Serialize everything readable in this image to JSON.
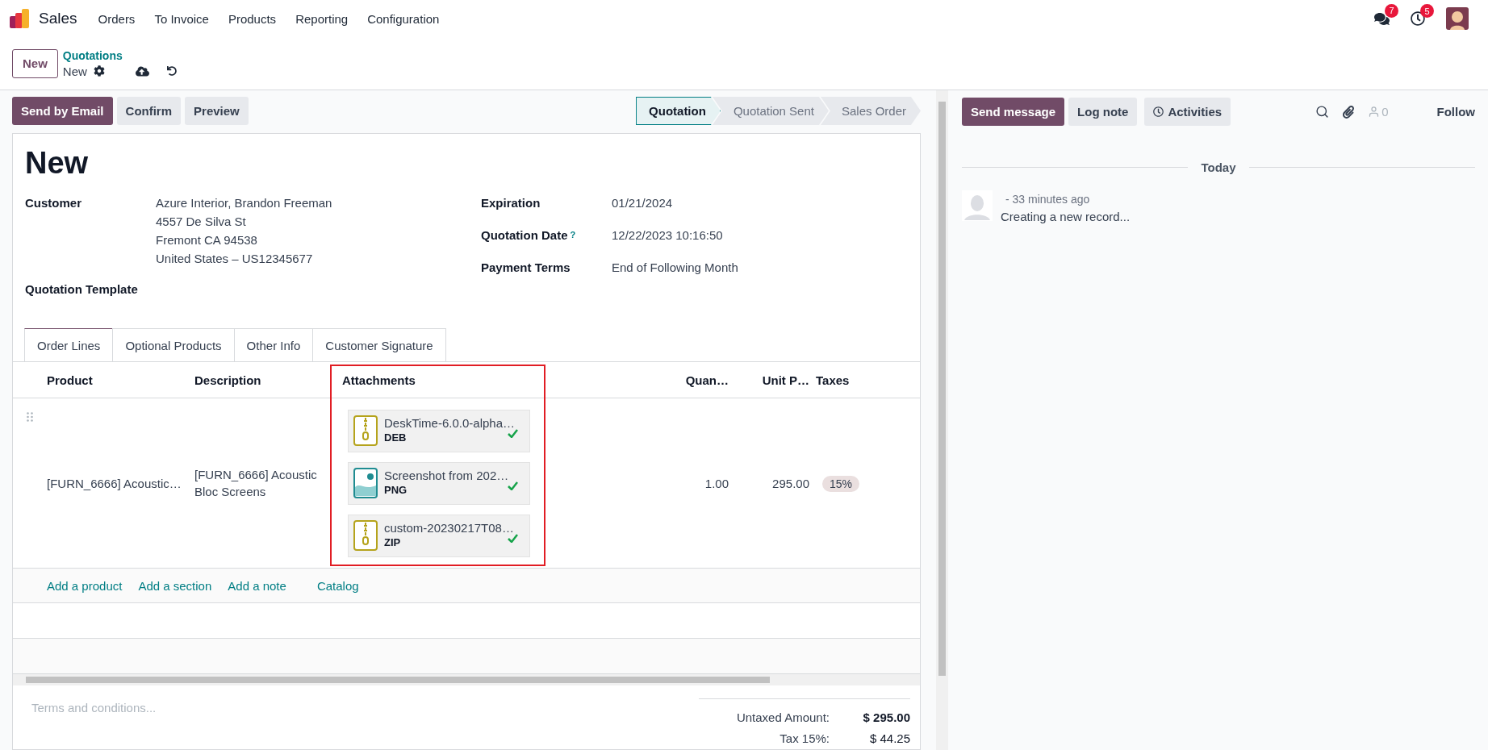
{
  "navbar": {
    "app": "Sales",
    "menu": [
      "Orders",
      "To Invoice",
      "Products",
      "Reporting",
      "Configuration"
    ],
    "messages_badge": "7",
    "activities_badge": "5"
  },
  "control_panel": {
    "new_button": "New",
    "breadcrumb": "Quotations",
    "record": "New"
  },
  "actions": [
    {
      "label": "Send by Email",
      "primary": true
    },
    {
      "label": "Confirm",
      "primary": false
    },
    {
      "label": "Preview",
      "primary": false
    }
  ],
  "statusbar": [
    {
      "label": "Quotation",
      "selected": true
    },
    {
      "label": "Quotation Sent",
      "selected": false
    },
    {
      "label": "Sales Order",
      "selected": false
    }
  ],
  "form": {
    "title": "New",
    "left_fields": [
      {
        "label": "Customer",
        "lines": [
          "Azure Interior, Brandon Freeman",
          "4557 De Silva St",
          "Fremont CA 94538",
          "United States – US12345677"
        ]
      },
      {
        "label": "Quotation Template"
      }
    ],
    "right_fields": [
      {
        "label": "Expiration",
        "value": "01/21/2024"
      },
      {
        "label": "Quotation Date",
        "help": "?",
        "value": "12/22/2023 10:16:50"
      },
      {
        "label": "Payment Terms",
        "value": "End of Following Month"
      }
    ]
  },
  "tabs": [
    {
      "label": "Order Lines",
      "selected": true
    },
    {
      "label": "Optional Products",
      "selected": false
    },
    {
      "label": "Other Info",
      "selected": false
    },
    {
      "label": "Customer Signature",
      "selected": false
    }
  ],
  "table": {
    "columns": [
      {
        "label": "Product",
        "highlighted": false
      },
      {
        "label": "Description",
        "highlighted": false
      },
      {
        "label": "Attachments",
        "highlighted": true
      },
      {
        "label": "Quan…",
        "highlighted": false
      },
      {
        "label": "Unit P…",
        "highlighted": false
      },
      {
        "label": "Taxes",
        "highlighted": false
      }
    ],
    "rows": [
      {
        "product": "[FURN_6666] Acoustic…",
        "description": "[FURN_6666] Acoustic Bloc Screens",
        "attachments": [
          {
            "name": "DeskTime-6.0.0-alpha…",
            "ext": "DEB",
            "kind": "archive",
            "uploaded": true
          },
          {
            "name": "Screenshot from 202…",
            "ext": "PNG",
            "kind": "image",
            "uploaded": true
          },
          {
            "name": "custom-20230217T08…",
            "ext": "ZIP",
            "kind": "archive",
            "uploaded": true
          }
        ],
        "quantity": "1.00",
        "unit_price": "295.00",
        "taxes": [
          "15%"
        ]
      }
    ],
    "add_links": [
      "Add a product",
      "Add a section",
      "Add a note",
      "Catalog"
    ]
  },
  "notes_placeholder": "Terms and conditions...",
  "totals": [
    {
      "label": "Untaxed Amount:",
      "value": "$ 295.00",
      "bold": true
    },
    {
      "label": "Tax 15%:",
      "value": "$ 44.25",
      "bold": false
    }
  ],
  "chatter": {
    "buttons": [
      {
        "label": "Send message",
        "kind": "primary"
      },
      {
        "label": "Log note",
        "kind": "plain"
      },
      {
        "label": "Activities",
        "kind": "activities"
      }
    ],
    "followers": "0",
    "follow": "Follow",
    "date_separator": "Today",
    "messages": [
      {
        "time": "- 33 minutes ago",
        "body": "Creating a new record..."
      }
    ]
  }
}
